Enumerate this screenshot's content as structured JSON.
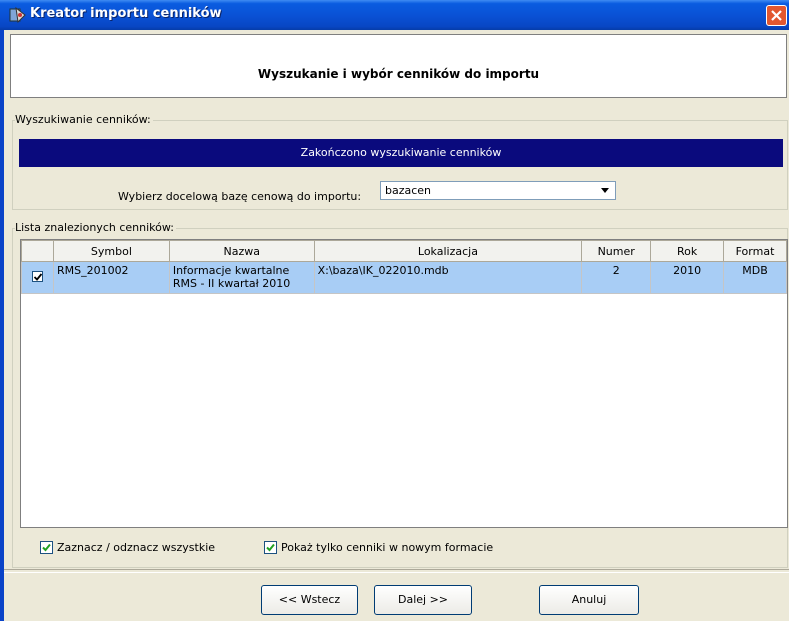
{
  "window": {
    "title": "Kreator importu cenników"
  },
  "header": {
    "title": "Wyszukanie i wybór cenników do importu"
  },
  "search_group": {
    "legend": "Wyszukiwanie cenników:",
    "status_text": "Zakończono wyszukiwanie cenników",
    "target_label": "Wybierz docelową bazę cenową do importu:",
    "target_value": "bazacen"
  },
  "list_group": {
    "legend": "Lista znalezionych cenników:",
    "columns": [
      "",
      "Symbol",
      "Nazwa",
      "Lokalizacja",
      "Numer",
      "Rok",
      "Format"
    ],
    "rows": [
      {
        "checked": true,
        "symbol": "RMS_201002",
        "name_line1": "Informacje kwartalne",
        "name_line2": "RMS - II kwartał 2010",
        "location": "X:\\baza\\IK_022010.mdb",
        "number": "2",
        "year": "2010",
        "format": "MDB"
      }
    ]
  },
  "options": {
    "select_all": "Zaznacz / odznacz wszystkie",
    "new_format_only": "Pokaż tylko cenniki w nowym formacie"
  },
  "buttons": {
    "back": "<< Wstecz",
    "next": "Dalej >>",
    "cancel": "Anuluj"
  },
  "colors": {
    "title_bar": "#0a52d6",
    "status_bar": "#0a0a7d",
    "selected_row": "#a8cdf5",
    "check": "#21a121"
  }
}
